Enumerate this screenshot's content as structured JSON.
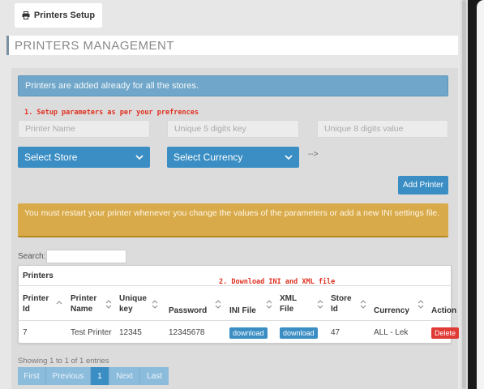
{
  "top_tab": {
    "label": "Printers Setup",
    "icon": "printer-icon"
  },
  "heading": "PRINTERS MANAGEMENT",
  "info": "Printers are added already for all the stores.",
  "annotations": {
    "step1": "1. Setup parameters as per your prefrences",
    "step2": "2. Download INI and XML file"
  },
  "form": {
    "printer_name_placeholder": "Printer Name",
    "key_placeholder": "Unique 5 digits key",
    "value_placeholder": "Unique 8 digits value",
    "select_store": "Select Store",
    "select_currency": "Select Currency",
    "arrow": "-->",
    "add_button": "Add Printer"
  },
  "warning": "You must restart your printer whenever you change the values of the parameters or add a new INI settings file.",
  "search_label": "Search:",
  "table": {
    "title": "Printers",
    "headers": {
      "printer_id": "Printer Id",
      "printer_name": "Printer Name",
      "unique_key": "Unique key",
      "password": "Password",
      "ini_file": "INI File",
      "xml_file": "XML File",
      "store_id": "Store Id",
      "currency": "Currency",
      "action": "Action"
    },
    "rows": [
      {
        "printer_id": "7",
        "printer_name": "Test Printer",
        "unique_key": "12345",
        "password": "12345678",
        "ini_file": "download",
        "xml_file": "download",
        "store_id": "47",
        "currency": "ALL - Lek",
        "action": "Delete"
      }
    ]
  },
  "showing": "Showing 1 to 1 of 1 entries",
  "pagination": {
    "first": "First",
    "previous": "Previous",
    "page": "1",
    "next": "Next",
    "last": "Last"
  },
  "colors": {
    "primary": "#3a8ec4",
    "info": "#6fa6c9",
    "warning": "#d9aa4a",
    "danger": "#e03a35",
    "annotation": "#e03020"
  }
}
